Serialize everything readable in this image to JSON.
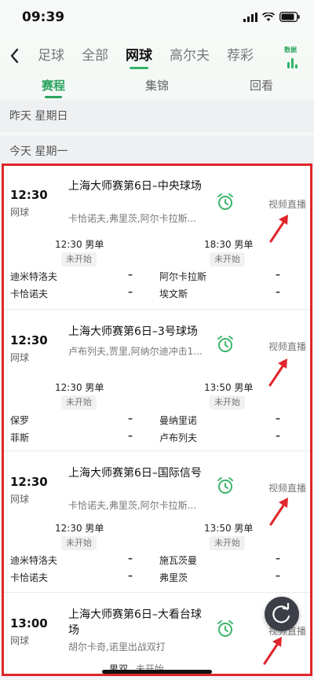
{
  "status_bar": {
    "time": "09:39"
  },
  "nav": {
    "tabs": [
      "足球",
      "全部",
      "网球",
      "高尔夫",
      "荐彩"
    ],
    "active_index": 2,
    "data_label": "数据"
  },
  "subtabs": {
    "items": [
      "赛程",
      "集锦",
      "回看"
    ],
    "active_index": 0
  },
  "days": {
    "yesterday": "昨天   星期日",
    "today": "今天   星期一"
  },
  "matches": [
    {
      "time": "12:30",
      "sport": "网球",
      "title": "上海大师赛第6日–中央球场",
      "players": "卡恰诺夫,弗里茨,阿尔卡拉斯...",
      "live": "视频直播",
      "sub": [
        {
          "time": "12:30",
          "type": "男单",
          "status": "未开始"
        },
        {
          "time": "18:30",
          "type": "男单",
          "status": "未开始"
        }
      ],
      "rows": [
        {
          "left": "迪米特洛夫",
          "right": "阿尔卡拉斯"
        },
        {
          "left": "卡恰诺夫",
          "right": "埃文斯"
        }
      ]
    },
    {
      "time": "12:30",
      "sport": "网球",
      "title": "上海大师赛第6日–3号球场",
      "players": "卢布列夫,贾里,阿纳尔迪冲击1...",
      "live": "视频直播",
      "sub": [
        {
          "time": "12:30",
          "type": "男单",
          "status": "未开始"
        },
        {
          "time": "13:50",
          "type": "男单",
          "status": "未开始"
        }
      ],
      "rows": [
        {
          "left": "保罗",
          "right": "曼纳里诺"
        },
        {
          "left": "菲斯",
          "right": "卢布列夫"
        }
      ]
    },
    {
      "time": "12:30",
      "sport": "网球",
      "title": "上海大师赛第6日–国际信号",
      "players": "卡恰诺夫,弗里茨,阿尔卡拉斯...",
      "live": "视频直播",
      "sub": [
        {
          "time": "12:30",
          "type": "男单",
          "status": "未开始"
        },
        {
          "time": "13:50",
          "type": "男单",
          "status": "未开始"
        }
      ],
      "rows": [
        {
          "left": "迪米特洛夫",
          "right": "施瓦茨曼"
        },
        {
          "left": "卡恰诺夫",
          "right": "弗里茨"
        }
      ]
    },
    {
      "time": "13:00",
      "sport": "网球",
      "title": "上海大师赛第6日–大看台球场",
      "players": "胡尔卡奇,诺里出战双打",
      "live": "视频直播",
      "sub": [
        {
          "type": "男双",
          "status": "未开始"
        }
      ]
    }
  ],
  "colors": {
    "accent": "#2ba360",
    "highlight": "#e0262a",
    "refresh_button": "#3c3f47"
  }
}
